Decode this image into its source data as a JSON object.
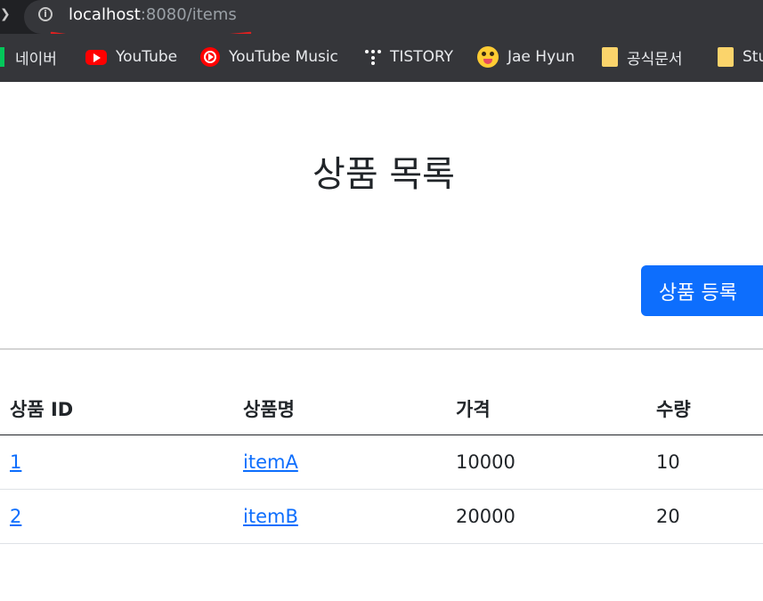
{
  "browser": {
    "url_host": "localhost",
    "url_rest": ":8080/items",
    "bookmarks": [
      {
        "label": "네이버",
        "icon": "naver-icon"
      },
      {
        "label": "YouTube",
        "icon": "youtube-icon"
      },
      {
        "label": "YouTube Music",
        "icon": "youtube-music-icon"
      },
      {
        "label": "TISTORY",
        "icon": "tistory-icon"
      },
      {
        "label": "Jae Hyun",
        "icon": "emoji-icon"
      },
      {
        "label": "공식문서",
        "icon": "folder-icon"
      },
      {
        "label": "Stu",
        "icon": "folder-icon"
      }
    ]
  },
  "page": {
    "title": "상품 목록",
    "register_button": "상품 등록"
  },
  "table": {
    "headers": [
      "상품 ID",
      "상품명",
      "가격",
      "수량"
    ],
    "rows": [
      {
        "id": "1",
        "name": "itemA",
        "price": "10000",
        "quantity": "10"
      },
      {
        "id": "2",
        "name": "itemB",
        "price": "20000",
        "quantity": "20"
      }
    ]
  },
  "colors": {
    "primary": "#0d6efd",
    "chrome_dark": "#202124",
    "chrome_bar": "#35363a",
    "annotation_red": "#e02020"
  }
}
